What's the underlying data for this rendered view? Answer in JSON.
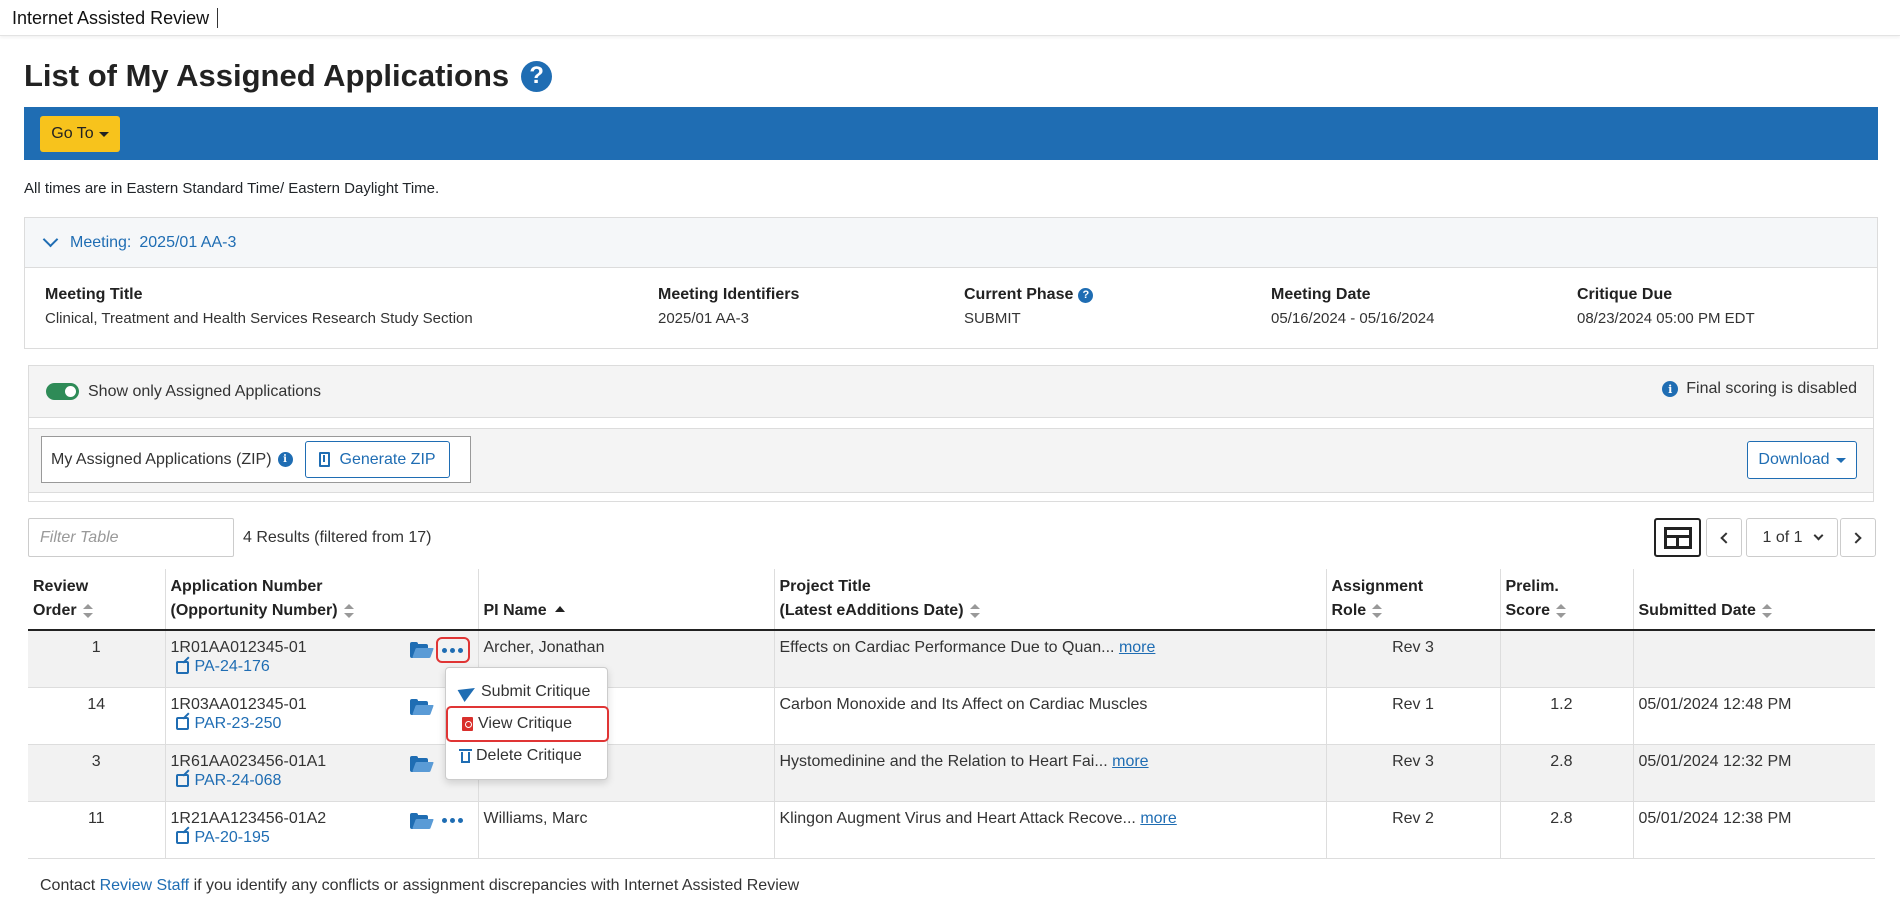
{
  "app": {
    "title": "Internet Assisted Review"
  },
  "page": {
    "title": "List of My Assigned Applications",
    "help_icon": "question-circle-icon"
  },
  "toolbar": {
    "goto_label": "Go To"
  },
  "timezone_note": "All times are in Eastern Standard Time/ Eastern Daylight Time.",
  "meeting": {
    "header_label": "Meeting:",
    "header_value": "2025/01 AA-3",
    "fields": [
      {
        "label": "Meeting Title",
        "value": "Clinical, Treatment and Health Services Research Study Section"
      },
      {
        "label": "Meeting Identifiers",
        "value": "2025/01 AA-3"
      },
      {
        "label": "Current Phase",
        "value": "SUBMIT"
      },
      {
        "label": "Meeting Date",
        "value": "05/16/2024 - 05/16/2024"
      },
      {
        "label": "Critique Due",
        "value": "08/23/2024 05:00 PM EDT"
      }
    ]
  },
  "filters": {
    "toggle_label": "Show only Assigned Applications",
    "toggle_on": true,
    "scoring_note": "Final scoring is disabled"
  },
  "zip": {
    "label": "My Assigned Applications (ZIP)",
    "generate_label": "Generate ZIP",
    "download_label": "Download"
  },
  "table_controls": {
    "filter_placeholder": "Filter Table",
    "results_text": "4 Results (filtered from 17)",
    "pagination": "1 of 1"
  },
  "columns": [
    {
      "line1": "Review",
      "line2": "Order"
    },
    {
      "line1": "Application Number",
      "line2": "(Opportunity Number)"
    },
    {
      "line1": "",
      "line2": "PI Name"
    },
    {
      "line1": "Project Title",
      "line2": "(Latest eAdditions Date)"
    },
    {
      "line1": "Assignment",
      "line2": "Role"
    },
    {
      "line1": "Prelim.",
      "line2": "Score"
    },
    {
      "line1": "",
      "line2": "Submitted Date"
    }
  ],
  "rows": [
    {
      "order": "1",
      "app_number": "1R01AA012345-01",
      "opportunity": "PA-24-176",
      "pi": "Archer, Jonathan",
      "title": "Effects on Cardiac Performance Due to Quan...",
      "more": "more",
      "role": "Rev 3",
      "score": "",
      "submitted": ""
    },
    {
      "order": "14",
      "app_number": "1R03AA012345-01",
      "opportunity": "PAR-23-250",
      "pi": "",
      "title": "Carbon Monoxide and Its Affect on Cardiac Muscles",
      "more": "",
      "role": "Rev 1",
      "score": "1.2",
      "submitted": "05/01/2024 12:48 PM"
    },
    {
      "order": "3",
      "app_number": "1R61AA023456-01A1",
      "opportunity": "PAR-24-068",
      "pi": "",
      "title": "Hystomedinine and the Relation to Heart Fai...",
      "more": "more",
      "role": "Rev 3",
      "score": "2.8",
      "submitted": "05/01/2024 12:32 PM"
    },
    {
      "order": "11",
      "app_number": "1R21AA123456-01A2",
      "opportunity": "PA-20-195",
      "pi": "Williams, Marc",
      "title": "Klingon Augment Virus and Heart Attack Recove...",
      "more": "more",
      "role": "Rev 2",
      "score": "2.8",
      "submitted": "05/01/2024 12:38 PM"
    }
  ],
  "action_menu": {
    "items": [
      {
        "label": "Submit Critique",
        "icon": "paper-plane-icon"
      },
      {
        "label": "View Critique",
        "icon": "file-pdf-icon"
      },
      {
        "label": "Delete Critique",
        "icon": "trash-icon"
      }
    ]
  },
  "footer": {
    "prefix": "Contact",
    "link": "Review Staff",
    "suffix": "if you identify any conflicts or assignment discrepancies with Internet Assisted Review"
  },
  "colors": {
    "primary": "#1f6db3",
    "goto": "#f7c31c",
    "highlight": "#e03535",
    "toggle": "#2e8b57"
  }
}
